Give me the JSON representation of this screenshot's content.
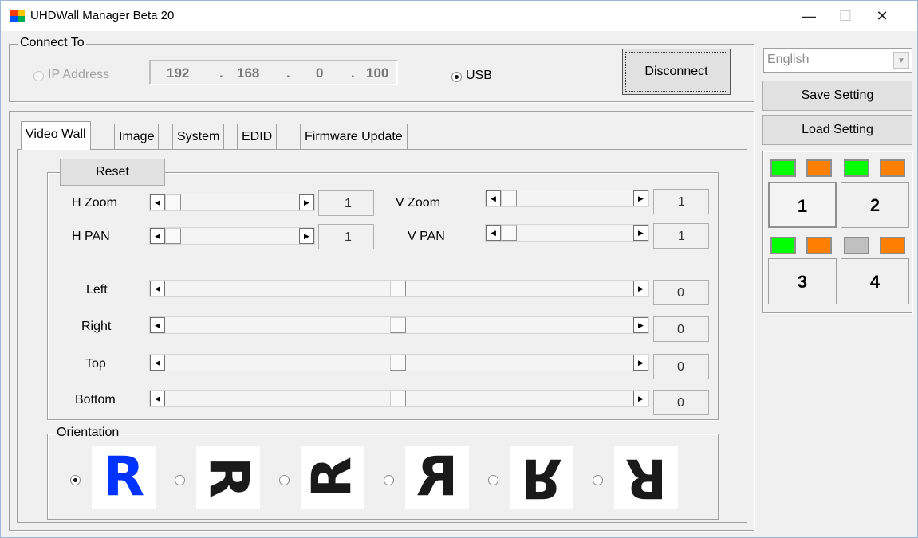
{
  "window": {
    "title": "UHDWall Manager Beta  20",
    "minimize_glyph": "—",
    "maximize_glyph": "☐",
    "close_glyph": "✕"
  },
  "connect": {
    "group_label": "Connect To",
    "ip_radio_label": "IP Address",
    "ip_selected": false,
    "ip_octets": [
      "192",
      "168",
      "0",
      "100"
    ],
    "ip_separator": ".",
    "usb_radio_label": "USB",
    "usb_selected": true,
    "disconnect_label": "Disconnect"
  },
  "side": {
    "language_value": "English",
    "dropdown_arrow_glyph": "▼",
    "save_label": "Save Setting",
    "load_label": "Load Setting"
  },
  "tabs": {
    "video_wall": "Video Wall",
    "image": "Image",
    "system": "System",
    "edid": "EDID",
    "firmware": "Firmware Update",
    "active": "Video Wall"
  },
  "video_wall": {
    "reset_label": "Reset",
    "arrow_left_glyph": "◀",
    "arrow_right_glyph": "▶",
    "h_zoom": {
      "label": "H Zoom",
      "value": "1"
    },
    "v_zoom": {
      "label": "V Zoom",
      "value": "1"
    },
    "h_pan": {
      "label": "H PAN",
      "value": "1"
    },
    "v_pan": {
      "label": "V PAN",
      "value": "1"
    },
    "left": {
      "label": "Left",
      "value": "0"
    },
    "right": {
      "label": "Right",
      "value": "0"
    },
    "top": {
      "label": "Top",
      "value": "0"
    },
    "bottom": {
      "label": "Bottom",
      "value": "0"
    }
  },
  "orientation": {
    "group_label": "Orientation",
    "letter": "R",
    "selected_index": 0,
    "options": [
      "normal",
      "rotate-90",
      "rotate-270",
      "mirror-horizontal",
      "mirror-vertical",
      "rotate-180"
    ]
  },
  "monitors": {
    "labels": [
      "1",
      "2",
      "3",
      "4"
    ],
    "selected": "1",
    "colors": {
      "green": "#00ff00",
      "orange": "#ff8000",
      "gray": "#c0c0c0"
    },
    "status": [
      [
        "green",
        "orange"
      ],
      [
        "green",
        "orange"
      ],
      [
        "green",
        "orange"
      ],
      [
        "gray",
        "orange"
      ]
    ]
  },
  "colors": {
    "selected_orientation": "#0033ff",
    "orientation_glyph": "#1a1a1a"
  }
}
